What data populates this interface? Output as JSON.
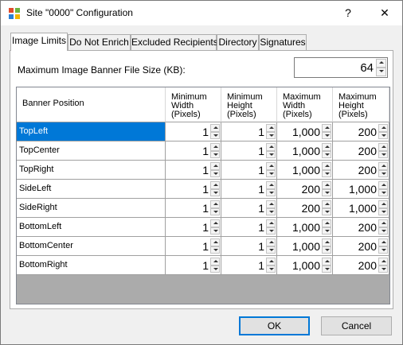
{
  "window": {
    "title": "Site \"0000\" Configuration",
    "help_glyph": "?",
    "close_glyph": "✕",
    "icon": "app-grid-icon"
  },
  "tabs": [
    {
      "label": "Image Limits",
      "active": true
    },
    {
      "label": "Do Not Enrich"
    },
    {
      "label": "Excluded Recipients"
    },
    {
      "label": "Directory"
    },
    {
      "label": "Signatures"
    }
  ],
  "max_size": {
    "label": "Maximum Image Banner File Size (KB):",
    "value": "64"
  },
  "grid": {
    "columns": [
      "Banner Position",
      "Minimum\nWidth\n(Pixels)",
      "Minimum\nHeight\n(Pixels)",
      "Maximum\nWidth\n(Pixels)",
      "Maximum\nHeight\n(Pixels)"
    ],
    "rows": [
      {
        "position": "TopLeft",
        "values": [
          "1",
          "1",
          "1,000",
          "200"
        ]
      },
      {
        "position": "TopCenter",
        "values": [
          "1",
          "1",
          "1,000",
          "200"
        ]
      },
      {
        "position": "TopRight",
        "values": [
          "1",
          "1",
          "1,000",
          "200"
        ]
      },
      {
        "position": "SideLeft",
        "values": [
          "1",
          "1",
          "200",
          "1,000"
        ]
      },
      {
        "position": "SideRight",
        "values": [
          "1",
          "1",
          "200",
          "1,000"
        ]
      },
      {
        "position": "BottomLeft",
        "values": [
          "1",
          "1",
          "1,000",
          "200"
        ]
      },
      {
        "position": "BottomCenter",
        "values": [
          "1",
          "1",
          "1,000",
          "200"
        ]
      },
      {
        "position": "BottomRight",
        "values": [
          "1",
          "1",
          "1,000",
          "200"
        ]
      }
    ],
    "selected_row": "TopLeft"
  },
  "buttons": {
    "ok": "OK",
    "cancel": "Cancel"
  },
  "colors": {
    "selection": "#0078d7",
    "grid_background": "#ababab"
  }
}
